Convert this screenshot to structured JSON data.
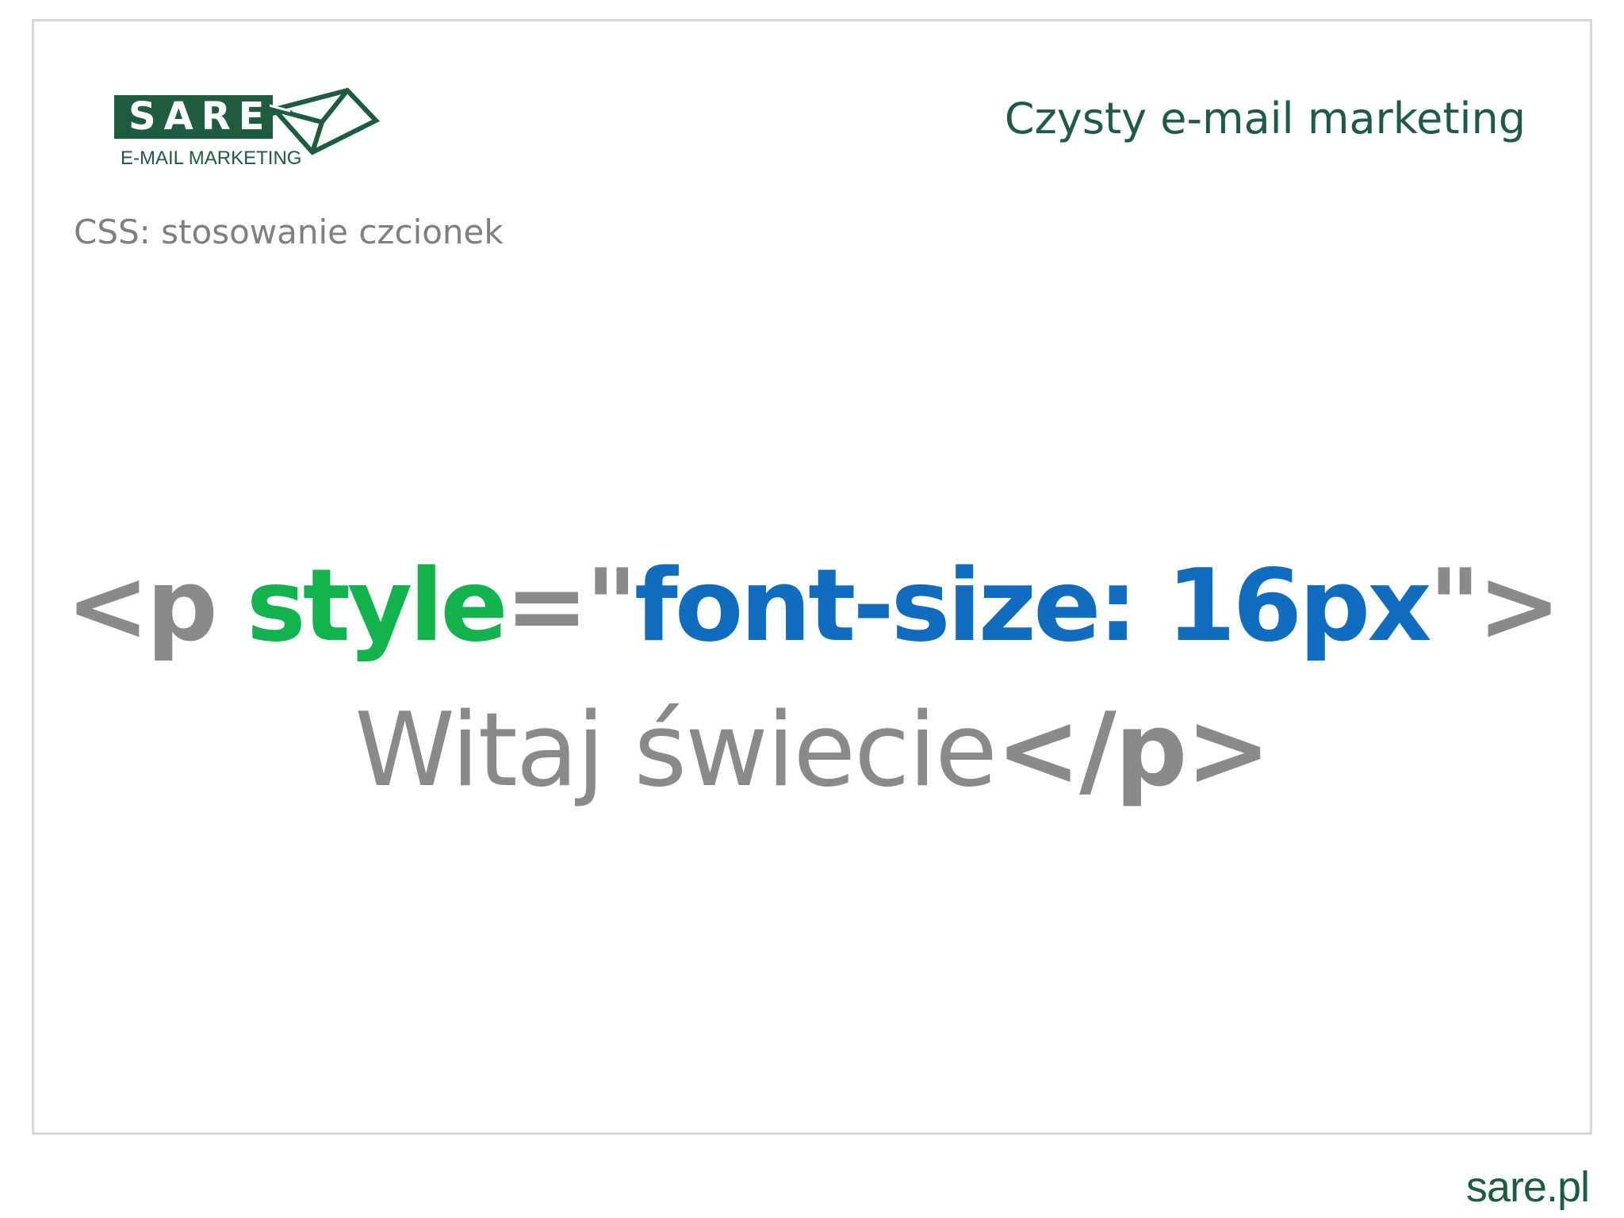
{
  "logo": {
    "wordmark": "SARE",
    "tagline": "E-MAIL MARKETING",
    "icon": "envelope-icon"
  },
  "header": {
    "tagline": "Czysty e-mail marketing"
  },
  "slide": {
    "title": "CSS: stosowanie czcionek"
  },
  "code": {
    "line1": {
      "open_tag": "<p ",
      "attr_name": "style",
      "equals_quote": "=\"",
      "attr_value": "font-size: 16px",
      "close_quote": "\">"
    },
    "line2": {
      "text": "Witaj świecie",
      "close_tag": "</p>"
    }
  },
  "footer": {
    "brand": "sare.pl"
  },
  "colors": {
    "brand_green": "#1d5c3e",
    "code_gray": "#8a8a8a",
    "attr_green": "#12b24f",
    "value_blue": "#0f6cbf",
    "title_gray": "#7f7f7f"
  }
}
